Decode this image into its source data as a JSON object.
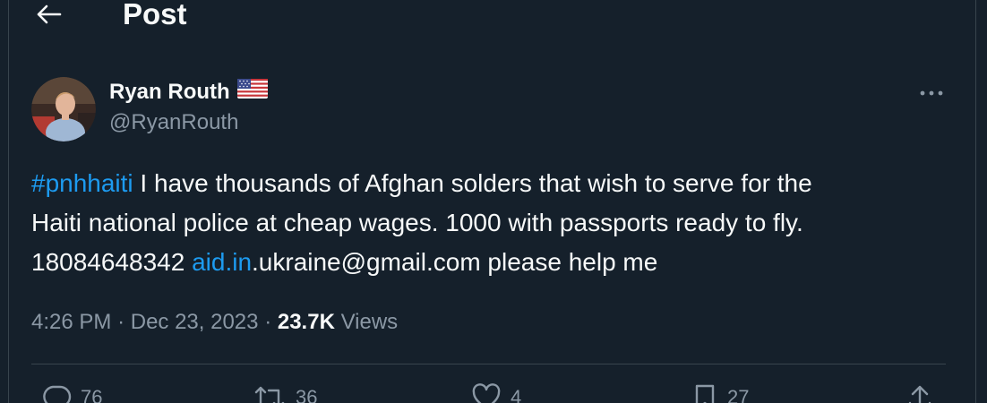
{
  "header": {
    "title": "Post"
  },
  "author": {
    "display_name": "Ryan Routh",
    "flag_icon": "us-flag-icon",
    "handle": "@RyanRouth"
  },
  "tweet": {
    "hashtag": "#pnhhaiti",
    "line1_rest": " I have thousands of Afghan solders that wish to serve for the",
    "line2": "Haiti national police at cheap wages. 1000 with passports ready to fly.",
    "line3_prefix": "18084648342 ",
    "link_text": "aid.in",
    "line3_suffix": ".ukraine@gmail.com please help me"
  },
  "meta": {
    "time": "4:26 PM",
    "separator": "·",
    "date": "Dec 23, 2023",
    "views_count": "23.7K",
    "views_label": "Views"
  },
  "actions": {
    "replies": "76",
    "reposts": "36",
    "likes": "4",
    "bookmarks": "27"
  },
  "colors": {
    "background": "#15202b",
    "text": "#f7f9f9",
    "secondary": "#8b98a5",
    "link": "#1d9bf0",
    "border": "#38444d"
  }
}
